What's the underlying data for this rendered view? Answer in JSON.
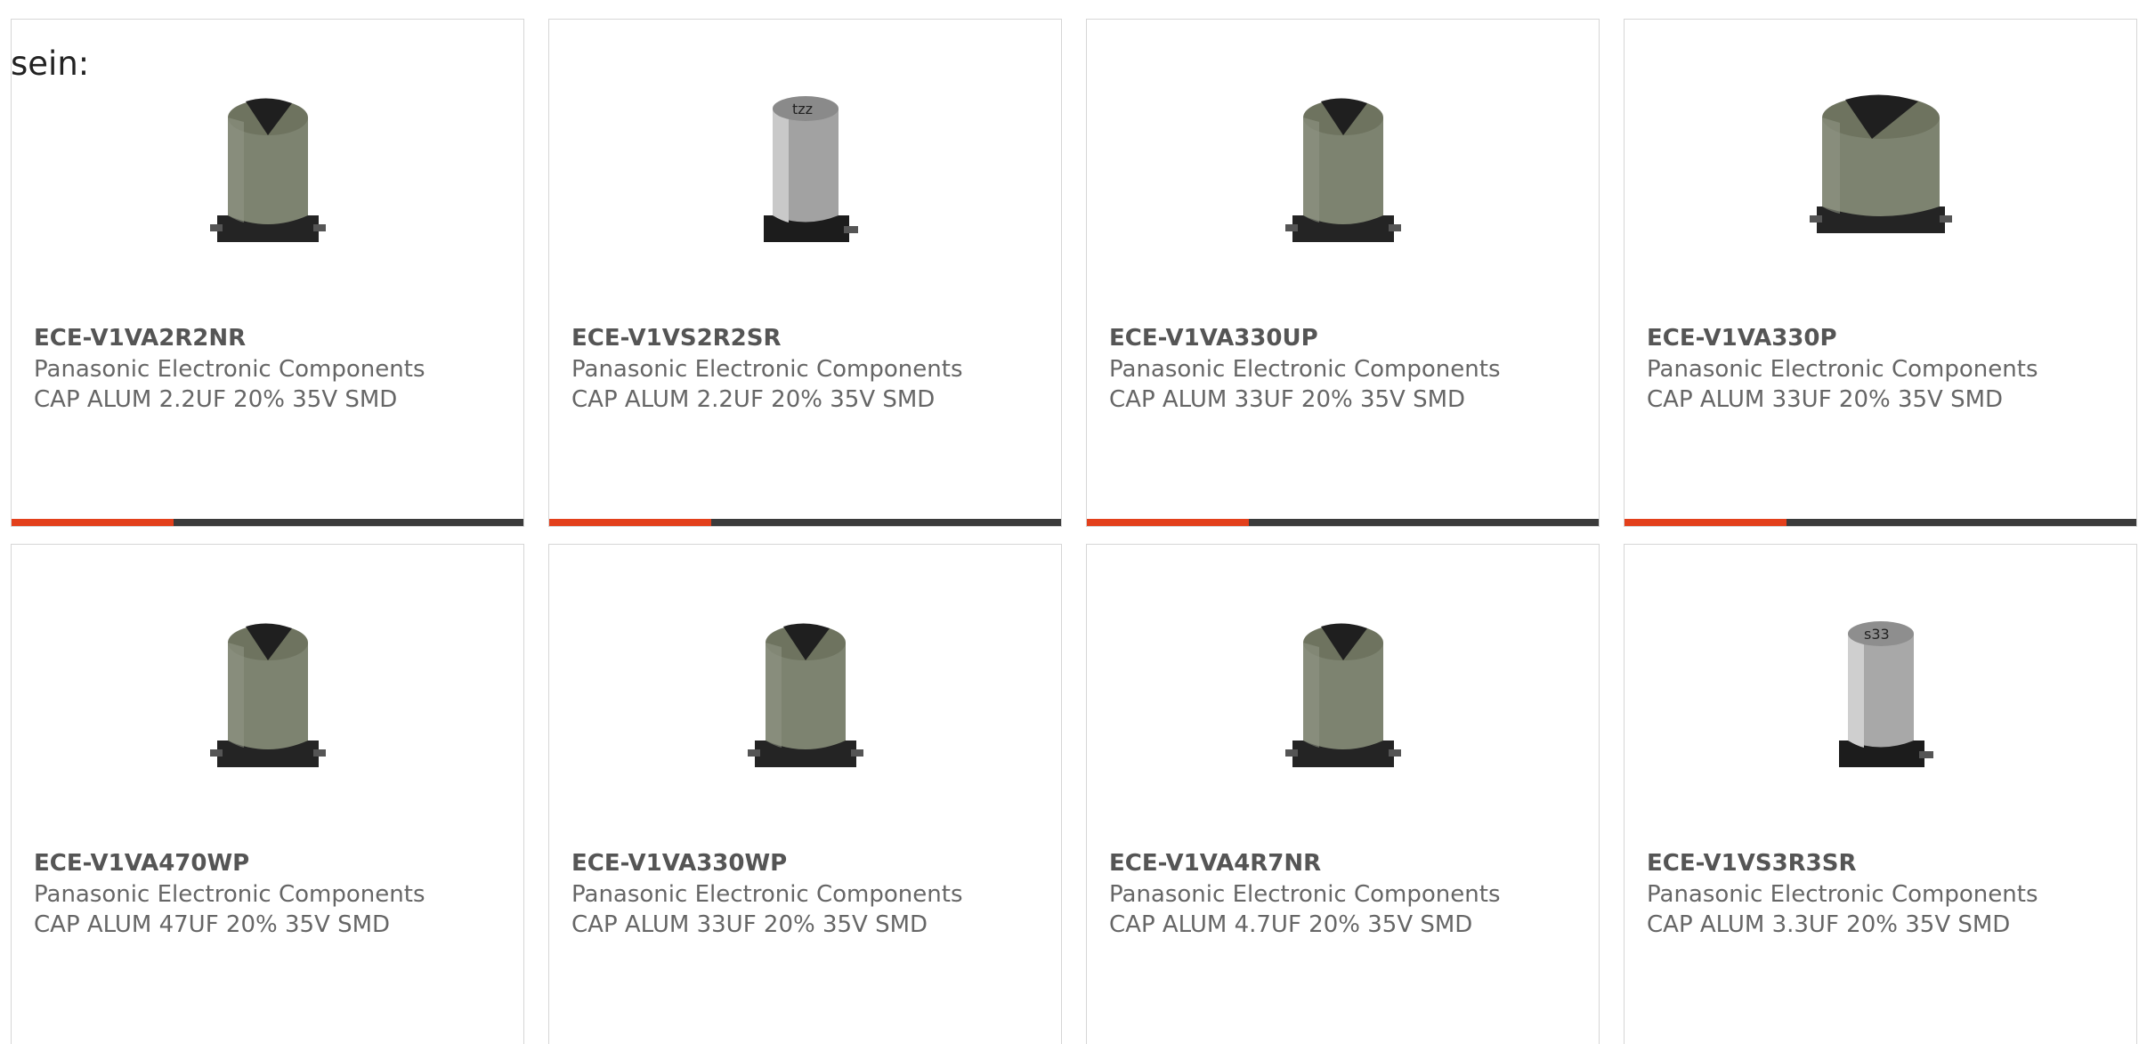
{
  "intro_text": "sein:",
  "colors": {
    "accent_bar": "#e3401c",
    "bar": "#3b3b3b",
    "border": "#d6d6d6",
    "capacitor_body": "#7e8470",
    "capacitor_base": "#222222"
  },
  "products": [
    {
      "part": "ECE-V1VA2R2NR",
      "manufacturer": "Panasonic Electronic Components",
      "description": "CAP ALUM 2.2UF 20% 35V SMD",
      "image_icon": "capacitor-olive-icon"
    },
    {
      "part": "ECE-V1VS2R2SR",
      "manufacturer": "Panasonic Electronic Components",
      "description": "CAP ALUM 2.2UF 20% 35V SMD",
      "image_icon": "capacitor-silver-icon"
    },
    {
      "part": "ECE-V1VA330UP",
      "manufacturer": "Panasonic Electronic Components",
      "description": "CAP ALUM 33UF 20% 35V SMD",
      "image_icon": "capacitor-olive-icon"
    },
    {
      "part": "ECE-V1VA330P",
      "manufacturer": "Panasonic Electronic Components",
      "description": "CAP ALUM 33UF 20% 35V SMD",
      "image_icon": "capacitor-olive-wide-icon"
    },
    {
      "part": "ECE-V1VA470WP",
      "manufacturer": "Panasonic Electronic Components",
      "description": "CAP ALUM 47UF 20% 35V SMD",
      "image_icon": "capacitor-olive-icon"
    },
    {
      "part": "ECE-V1VA330WP",
      "manufacturer": "Panasonic Electronic Components",
      "description": "CAP ALUM 33UF 20% 35V SMD",
      "image_icon": "capacitor-olive-icon"
    },
    {
      "part": "ECE-V1VA4R7NR",
      "manufacturer": "Panasonic Electronic Components",
      "description": "CAP ALUM 4.7UF 20% 35V SMD",
      "image_icon": "capacitor-olive-icon"
    },
    {
      "part": "ECE-V1VS3R3SR",
      "manufacturer": "Panasonic Electronic Components",
      "description": "CAP ALUM 3.3UF 20% 35V SMD",
      "image_icon": "capacitor-silver-icon"
    }
  ]
}
